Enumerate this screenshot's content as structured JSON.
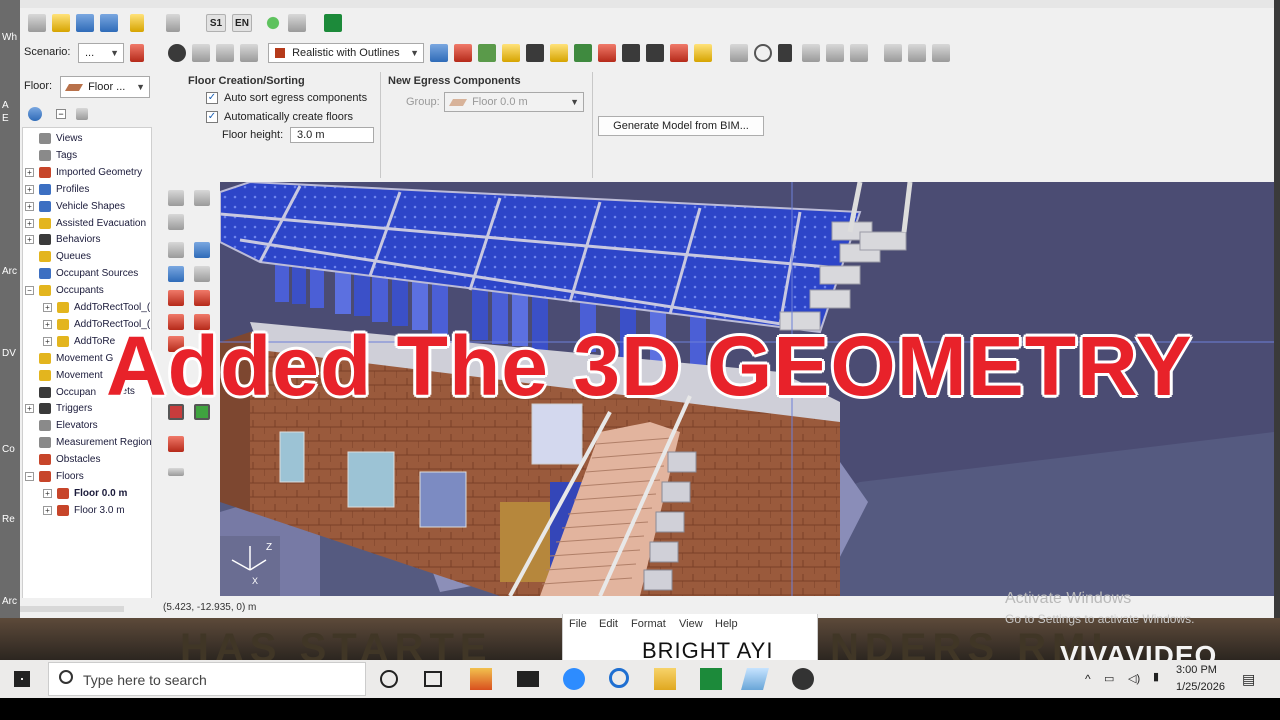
{
  "desktop": {
    "left_labels": [
      "Wh",
      "A",
      "E",
      "Arc",
      "DV",
      "Co",
      "Re",
      "Arc"
    ]
  },
  "toolbar": {
    "sim_label": "S1",
    "en_label": "EN",
    "scenario_label": "Scenario:",
    "scenario_value": "...",
    "view_mode": "Realistic with Outlines"
  },
  "floor_selector": {
    "label": "Floor:",
    "value": "Floor ..."
  },
  "floor_creation": {
    "title": "Floor Creation/Sorting",
    "auto_sort_label": "Auto sort egress components",
    "auto_sort_checked": true,
    "auto_create_label": "Automatically create floors",
    "auto_create_checked": true,
    "floor_height_label": "Floor height:",
    "floor_height_value": "3.0 m"
  },
  "egress": {
    "title": "New Egress Components",
    "group_label": "Group:",
    "group_value": "Floor 0.0 m"
  },
  "generate_button": "Generate Model from BIM...",
  "tree": [
    {
      "label": "Views",
      "level": 1,
      "exp": "",
      "icon": "gray"
    },
    {
      "label": "Tags",
      "level": 1,
      "exp": "",
      "icon": "gray"
    },
    {
      "label": "Imported Geometry",
      "level": 1,
      "exp": "+",
      "icon": "red"
    },
    {
      "label": "Profiles",
      "level": 1,
      "exp": "+",
      "icon": "blue"
    },
    {
      "label": "Vehicle Shapes",
      "level": 1,
      "exp": "+",
      "icon": "blue"
    },
    {
      "label": "Assisted Evacuation",
      "level": 1,
      "exp": "+",
      "icon": "yellow"
    },
    {
      "label": "Behaviors",
      "level": 1,
      "exp": "+",
      "icon": "dark"
    },
    {
      "label": "Queues",
      "level": 1,
      "exp": "",
      "icon": "yellow"
    },
    {
      "label": "Occupant Sources",
      "level": 1,
      "exp": "",
      "icon": "blue"
    },
    {
      "label": "Occupants",
      "level": 1,
      "exp": "−",
      "icon": "yellow"
    },
    {
      "label": "AddToRectTool_(",
      "level": 2,
      "exp": "+",
      "icon": "yellow"
    },
    {
      "label": "AddToRectTool_(",
      "level": 2,
      "exp": "+",
      "icon": "yellow"
    },
    {
      "label": "AddToRe",
      "level": 2,
      "exp": "+",
      "icon": "yellow"
    },
    {
      "label": "Movement G",
      "level": 1,
      "exp": "",
      "icon": "yellow"
    },
    {
      "label": "Movement",
      "level": 1,
      "exp": "",
      "icon": "yellow"
    },
    {
      "label": "Occupan",
      "level": 1,
      "exp": "",
      "icon": "dark"
    },
    {
      "label": "Triggers",
      "level": 1,
      "exp": "+",
      "icon": "dark"
    },
    {
      "label": "Elevators",
      "level": 1,
      "exp": "",
      "icon": "gray"
    },
    {
      "label": "Measurement Region",
      "level": 1,
      "exp": "",
      "icon": "gray"
    },
    {
      "label": "Obstacles",
      "level": 1,
      "exp": "",
      "icon": "red"
    },
    {
      "label": "Floors",
      "level": 1,
      "exp": "−",
      "icon": "red"
    },
    {
      "label": "Floor 0.0 m",
      "level": 2,
      "exp": "+",
      "icon": "red",
      "bold": true
    },
    {
      "label": "Floor 3.0 m",
      "level": 2,
      "exp": "+",
      "icon": "red"
    }
  ],
  "tree_fragment": "gets",
  "status": {
    "coords": "(5.423, -12.935, 0) m"
  },
  "overlay_text": "Added The 3D GEOMETRY",
  "notepad": {
    "menu": [
      "File",
      "Edit",
      "Format",
      "View",
      "Help"
    ],
    "content": "BRIGHT AYI"
  },
  "watermark": {
    "activate_title": "Activate Windows",
    "activate_sub": "Go to Settings to activate Windows.",
    "brand": "VIVAVIDEO"
  },
  "taskbar": {
    "search_placeholder": "Type here to search",
    "time": "3:00 PM",
    "date": "1/25/2026"
  },
  "colors": {
    "overlay_red": "#e8222a",
    "sky": "#4b4c73",
    "ground": "#565a80",
    "panel_blue": "#2b46c9"
  }
}
